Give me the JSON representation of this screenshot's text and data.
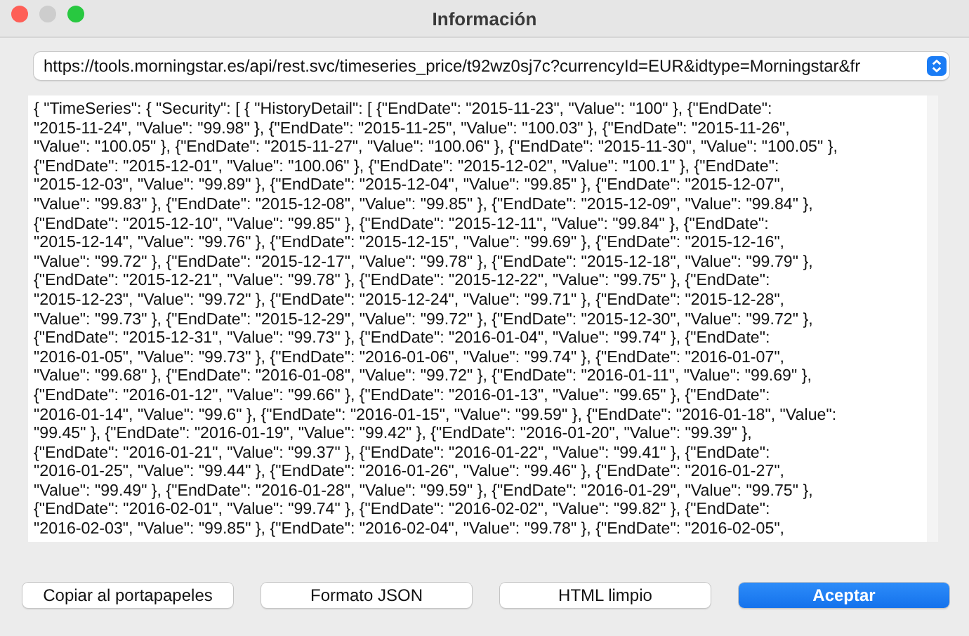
{
  "window": {
    "title": "Información"
  },
  "url_select": {
    "value": "https://tools.morningstar.es/api/rest.svc/timeseries_price/t92wz0sj7c?currencyId=EUR&idtype=Morningstar&fr"
  },
  "text_area": {
    "lines": [
      "{ \"TimeSeries\": { \"Security\": [ { \"HistoryDetail\": [ {\"EndDate\": \"2015-11-23\", \"Value\": \"100\" }, {\"EndDate\":",
      "\"2015-11-24\", \"Value\": \"99.98\" }, {\"EndDate\": \"2015-11-25\", \"Value\": \"100.03\" }, {\"EndDate\": \"2015-11-26\",",
      "\"Value\": \"100.05\" }, {\"EndDate\": \"2015-11-27\", \"Value\": \"100.06\" }, {\"EndDate\": \"2015-11-30\", \"Value\": \"100.05\" },",
      "{\"EndDate\": \"2015-12-01\", \"Value\": \"100.06\" }, {\"EndDate\": \"2015-12-02\", \"Value\": \"100.1\" }, {\"EndDate\":",
      "\"2015-12-03\", \"Value\": \"99.89\" }, {\"EndDate\": \"2015-12-04\", \"Value\": \"99.85\" }, {\"EndDate\": \"2015-12-07\",",
      "\"Value\": \"99.83\" }, {\"EndDate\": \"2015-12-08\", \"Value\": \"99.85\" }, {\"EndDate\": \"2015-12-09\", \"Value\": \"99.84\" },",
      "{\"EndDate\": \"2015-12-10\", \"Value\": \"99.85\" }, {\"EndDate\": \"2015-12-11\", \"Value\": \"99.84\" }, {\"EndDate\":",
      "\"2015-12-14\", \"Value\": \"99.76\" }, {\"EndDate\": \"2015-12-15\", \"Value\": \"99.69\" }, {\"EndDate\": \"2015-12-16\",",
      "\"Value\": \"99.72\" }, {\"EndDate\": \"2015-12-17\", \"Value\": \"99.78\" }, {\"EndDate\": \"2015-12-18\", \"Value\": \"99.79\" },",
      "{\"EndDate\": \"2015-12-21\", \"Value\": \"99.78\" }, {\"EndDate\": \"2015-12-22\", \"Value\": \"99.75\" }, {\"EndDate\":",
      "\"2015-12-23\", \"Value\": \"99.72\" }, {\"EndDate\": \"2015-12-24\", \"Value\": \"99.71\" }, {\"EndDate\": \"2015-12-28\",",
      "\"Value\": \"99.73\" }, {\"EndDate\": \"2015-12-29\", \"Value\": \"99.72\" }, {\"EndDate\": \"2015-12-30\", \"Value\": \"99.72\" },",
      "{\"EndDate\": \"2015-12-31\", \"Value\": \"99.73\" }, {\"EndDate\": \"2016-01-04\", \"Value\": \"99.74\" }, {\"EndDate\":",
      "\"2016-01-05\", \"Value\": \"99.73\" }, {\"EndDate\": \"2016-01-06\", \"Value\": \"99.74\" }, {\"EndDate\": \"2016-01-07\",",
      "\"Value\": \"99.68\" }, {\"EndDate\": \"2016-01-08\", \"Value\": \"99.72\" }, {\"EndDate\": \"2016-01-11\", \"Value\": \"99.69\" },",
      "{\"EndDate\": \"2016-01-12\", \"Value\": \"99.66\" }, {\"EndDate\": \"2016-01-13\", \"Value\": \"99.65\" }, {\"EndDate\":",
      "\"2016-01-14\", \"Value\": \"99.6\" }, {\"EndDate\": \"2016-01-15\", \"Value\": \"99.59\" }, {\"EndDate\": \"2016-01-18\", \"Value\":",
      "\"99.45\" }, {\"EndDate\": \"2016-01-19\", \"Value\": \"99.42\" }, {\"EndDate\": \"2016-01-20\", \"Value\": \"99.39\" },",
      "{\"EndDate\": \"2016-01-21\", \"Value\": \"99.37\" }, {\"EndDate\": \"2016-01-22\", \"Value\": \"99.41\" }, {\"EndDate\":",
      "\"2016-01-25\", \"Value\": \"99.44\" }, {\"EndDate\": \"2016-01-26\", \"Value\": \"99.46\" }, {\"EndDate\": \"2016-01-27\",",
      "\"Value\": \"99.49\" }, {\"EndDate\": \"2016-01-28\", \"Value\": \"99.59\" }, {\"EndDate\": \"2016-01-29\", \"Value\": \"99.75\" },",
      "{\"EndDate\": \"2016-02-01\", \"Value\": \"99.74\" }, {\"EndDate\": \"2016-02-02\", \"Value\": \"99.82\" }, {\"EndDate\":",
      "\"2016-02-03\", \"Value\": \"99.85\" }, {\"EndDate\": \"2016-02-04\", \"Value\": \"99.78\" }, {\"EndDate\": \"2016-02-05\","
    ]
  },
  "buttons": [
    {
      "label": "Copiar al portapapeles",
      "kind": "normal"
    },
    {
      "label": "Formato JSON",
      "kind": "normal"
    },
    {
      "label": "HTML limpio",
      "kind": "normal"
    },
    {
      "label": "Aceptar",
      "kind": "default"
    }
  ]
}
